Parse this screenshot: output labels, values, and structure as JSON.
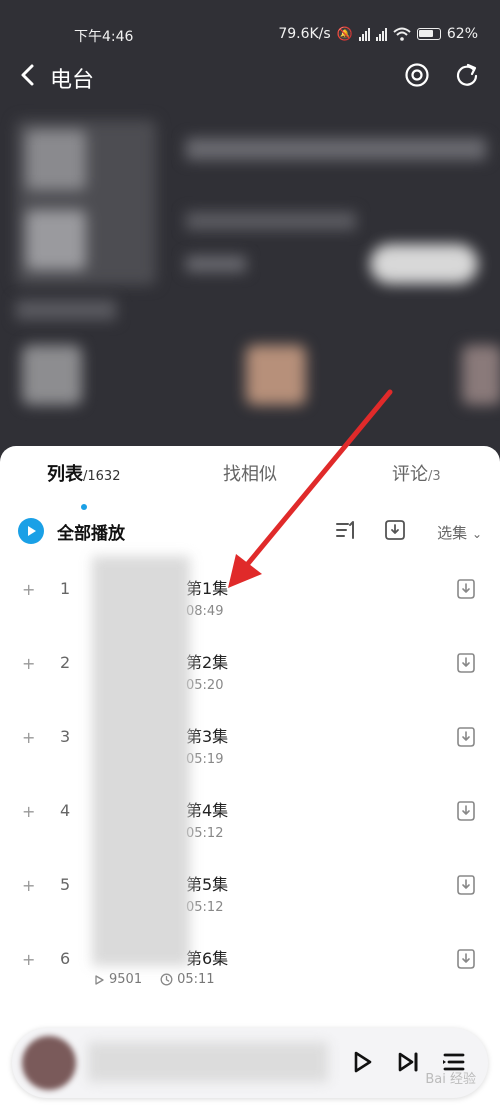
{
  "status_bar": {
    "time": "下午4:46",
    "speed": "79.6K/s",
    "battery": "62%"
  },
  "header": {
    "title": "电台"
  },
  "tabs": [
    {
      "label": "列表",
      "count": "/1632"
    },
    {
      "label": "找相似",
      "count": ""
    },
    {
      "label": "评论",
      "count": "/3"
    }
  ],
  "toolbar": {
    "play_all": "全部播放",
    "select_episodes": "选集"
  },
  "episodes": [
    {
      "index": "1",
      "title": "第1集",
      "duration": "08:49"
    },
    {
      "index": "2",
      "title": "第2集",
      "duration": "05:20"
    },
    {
      "index": "3",
      "title": "第3集",
      "duration": "05:19"
    },
    {
      "index": "4",
      "title": "第4集",
      "duration": "05:12"
    },
    {
      "index": "5",
      "title": "第5集",
      "duration": "05:12"
    },
    {
      "index": "6",
      "title": "第6集",
      "plays": "9501",
      "duration": "05:11"
    }
  ],
  "watermark": "Bai 经验",
  "colors": {
    "accent": "#1aa0e6",
    "arrow": "#e02a2a"
  }
}
